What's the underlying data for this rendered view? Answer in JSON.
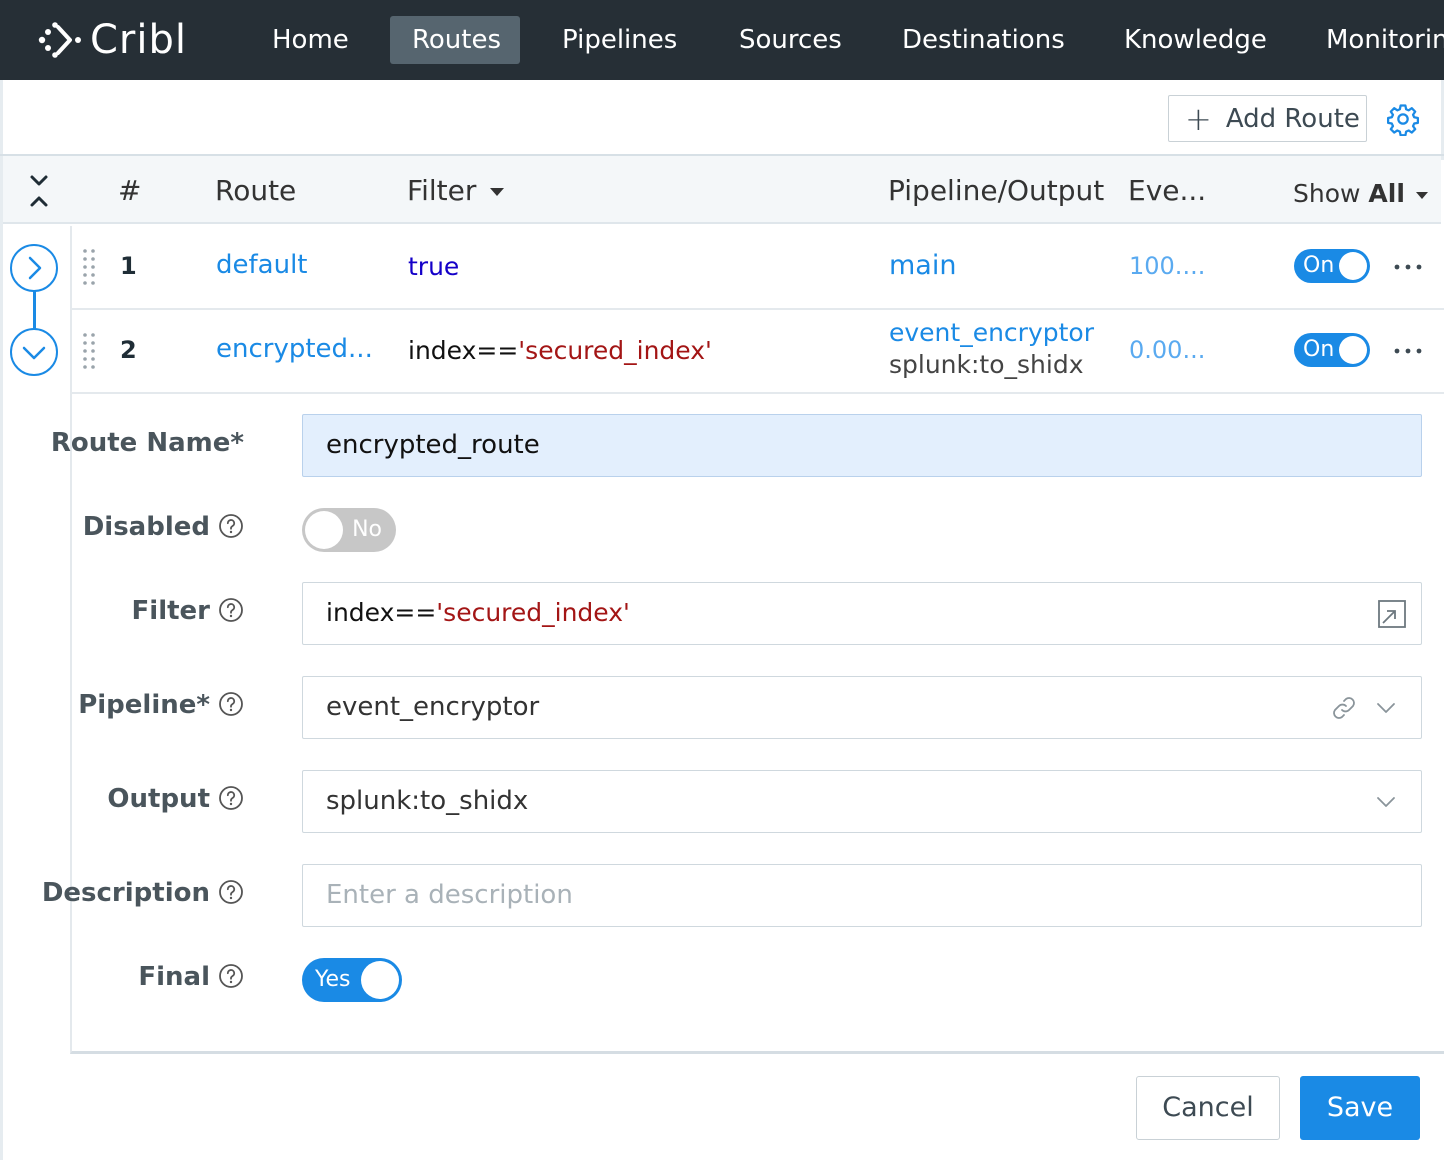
{
  "app": {
    "logo_text": "Cribl"
  },
  "nav": {
    "items": [
      {
        "label": "Home",
        "active": false
      },
      {
        "label": "Routes",
        "active": true
      },
      {
        "label": "Pipelines",
        "active": false
      },
      {
        "label": "Sources",
        "active": false
      },
      {
        "label": "Destinations",
        "active": false
      },
      {
        "label": "Knowledge",
        "active": false
      },
      {
        "label": "Monitoring",
        "active": false
      }
    ]
  },
  "toolbar": {
    "add_route_label": "Add Route",
    "settings_icon": "gear-icon"
  },
  "table": {
    "headers": {
      "num": "#",
      "route": "Route",
      "filter": "Filter",
      "pipeline_output": "Pipeline/Output",
      "events": "Eve...",
      "show_prefix": "Show",
      "show_value": "All"
    },
    "rows": [
      {
        "num": "1",
        "route": "default",
        "filter_kw": "true",
        "pipeline": "main",
        "output": "",
        "events": "100....",
        "toggle": "On"
      },
      {
        "num": "2",
        "route": "encrypted...",
        "filter_prefix": "index==",
        "filter_str": "'secured_index'",
        "pipeline": "event_encryptor",
        "output": "splunk:to_shidx",
        "events": "0.00...",
        "toggle": "On"
      }
    ]
  },
  "form": {
    "route_name": {
      "label": "Route Name*",
      "value": "encrypted_route"
    },
    "disabled": {
      "label": "Disabled",
      "value": "No"
    },
    "filter": {
      "label": "Filter",
      "prefix": "index==",
      "str": "'secured_index'"
    },
    "pipeline": {
      "label": "Pipeline*",
      "value": "event_encryptor"
    },
    "output": {
      "label": "Output",
      "value": "splunk:to_shidx"
    },
    "description": {
      "label": "Description",
      "placeholder": "Enter a description"
    },
    "final": {
      "label": "Final",
      "value": "Yes"
    }
  },
  "actions": {
    "cancel": "Cancel",
    "save": "Save"
  },
  "colors": {
    "nav_bg": "#262f36",
    "accent": "#1a8ae5",
    "string": "#a31515",
    "keyword": "#1400c8"
  }
}
